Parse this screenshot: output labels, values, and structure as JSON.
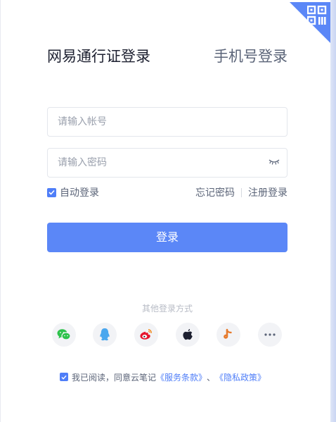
{
  "tabs": {
    "active": "网易通行证登录",
    "inactive": "手机号登录"
  },
  "form": {
    "account_placeholder": "请输入帐号",
    "password_placeholder": "请输入密码",
    "auto_login_label": "自动登录",
    "auto_login_checked": true,
    "forgot_password": "忘记密码",
    "register_login": "注册登录",
    "login_button": "登录"
  },
  "other_login": {
    "title": "其他登录方式",
    "providers": [
      "wechat-icon",
      "qq-icon",
      "weibo-icon",
      "apple-icon",
      "tiktok-icon",
      "more-icon"
    ]
  },
  "agreement": {
    "checked": true,
    "prefix": "我已阅读，同意云笔记",
    "terms": "《服务条款》",
    "separator": "、",
    "privacy": "《隐私政策》"
  },
  "colors": {
    "accent": "#5b87f7",
    "checkbox": "#4f7ef8",
    "wechat": "#2dc24b",
    "qq": "#4aa7ee",
    "weibo": "#e6162d",
    "apple": "#1d2030",
    "tiktok": "#e67a2c"
  }
}
